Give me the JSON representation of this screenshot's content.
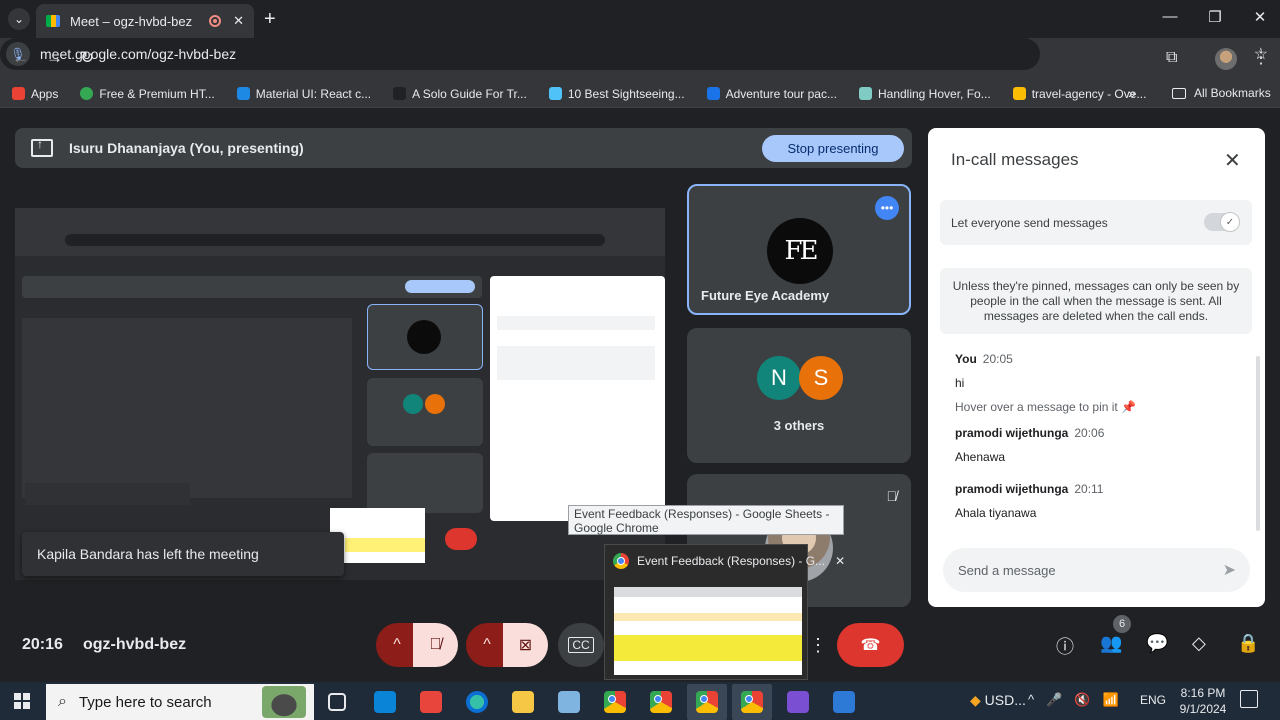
{
  "browser": {
    "tab_title": "Meet – ogz-hvbd-bez",
    "url": "meet.google.com/ogz-hvbd-bez",
    "bookmarks": [
      {
        "label": "Apps",
        "color": "#ea4335"
      },
      {
        "label": "Free & Premium HT...",
        "color": "#34a853"
      },
      {
        "label": "Material UI: React c...",
        "color": "#1e88e5"
      },
      {
        "label": "A Solo Guide For Tr...",
        "color": "#202124"
      },
      {
        "label": "10 Best Sightseeing...",
        "color": "#4fc3f7"
      },
      {
        "label": "Adventure tour pac...",
        "color": "#1a73e8"
      },
      {
        "label": "Handling Hover, Fo...",
        "color": "#80cbc4"
      },
      {
        "label": "travel-agency - Ove...",
        "color": "#fbbc04"
      }
    ],
    "all_bookmarks": "All Bookmarks"
  },
  "meet": {
    "presenting_label": "Isuru Dhananjaya (You, presenting)",
    "stop_presenting": "Stop presenting",
    "tiles": {
      "featured_name": "Future Eye Academy",
      "featured_logo": "FE",
      "others_label": "3 others",
      "avatars": [
        {
          "letter": "N",
          "color": "#12857a"
        },
        {
          "letter": "S",
          "color": "#e8710a"
        }
      ]
    },
    "toast": "Kapila Bandara has left the meeting",
    "tooltip": "Event Feedback (Responses) - Google Sheets - Google Chrome",
    "preview_title": "Event Feedback (Responses) - G...",
    "clock": "20:16",
    "meeting_code": "ogz-hvbd-bez",
    "participant_count": "6"
  },
  "chat": {
    "title": "In-call messages",
    "toggle_label": "Let everyone send messages",
    "info": "Unless they're pinned, messages can only be seen by people in the call when the message is sent. All messages are deleted when the call ends.",
    "messages": [
      {
        "sender": "You",
        "time": "20:05",
        "text": "hi",
        "hint": "Hover over a message to pin it"
      },
      {
        "sender": "pramodi wijethunga",
        "time": "20:06",
        "text": "Ahenawa"
      },
      {
        "sender": "pramodi wijethunga",
        "time": "20:11",
        "text": "Ahala tiyanawa"
      }
    ],
    "send_placeholder": "Send a message"
  },
  "taskbar": {
    "search_placeholder": "Type here to search",
    "tray_ticker": "USD...",
    "language": "ENG",
    "time": "8:16 PM",
    "date": "9/1/2024"
  }
}
